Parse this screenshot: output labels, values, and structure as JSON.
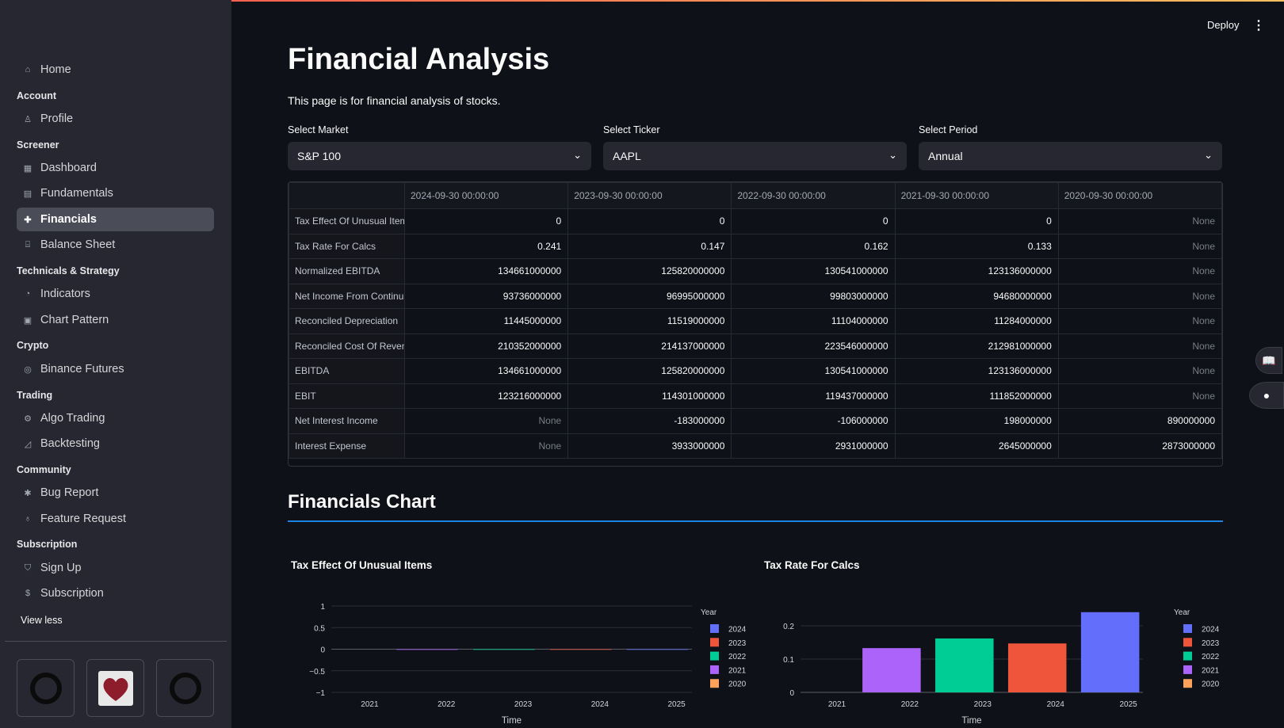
{
  "sidebar": {
    "items": [
      {
        "label": "Home",
        "icon": "home-icon",
        "glyph": "⌂"
      },
      {
        "label": "Profile",
        "icon": "user-icon",
        "glyph": "♙"
      },
      {
        "label": "Dashboard",
        "icon": "dashboard-icon",
        "glyph": "▦"
      },
      {
        "label": "Fundamentals",
        "icon": "document-icon",
        "glyph": "▤"
      },
      {
        "label": "Financials",
        "icon": "puzzle-icon",
        "glyph": "✚"
      },
      {
        "label": "Balance Sheet",
        "icon": "bank-icon",
        "glyph": "⌸"
      },
      {
        "label": "Indicators",
        "icon": "gauge-icon",
        "glyph": "◔"
      },
      {
        "label": "Chart Pattern",
        "icon": "chart-icon",
        "glyph": "▣"
      },
      {
        "label": "Binance Futures",
        "icon": "currency-icon",
        "glyph": "◎"
      },
      {
        "label": "Algo Trading",
        "icon": "robot-icon",
        "glyph": "⚙"
      },
      {
        "label": "Backtesting",
        "icon": "area-chart-icon",
        "glyph": "◿"
      },
      {
        "label": "Bug Report",
        "icon": "bug-icon",
        "glyph": "✱"
      },
      {
        "label": "Feature Request",
        "icon": "lightbulb-icon",
        "glyph": "♁"
      },
      {
        "label": "Sign Up",
        "icon": "shield-icon",
        "glyph": "⛉"
      },
      {
        "label": "Subscription",
        "icon": "dollar-icon",
        "glyph": "$"
      }
    ],
    "sections": [
      "Account",
      "Screener",
      "Technicals & Strategy",
      "Crypto",
      "Trading",
      "Community",
      "Subscription"
    ],
    "view_less": "View less"
  },
  "header": {
    "deploy": "Deploy",
    "menu": "⋮"
  },
  "page": {
    "title": "Financial Analysis",
    "subtitle": "This page is for financial analysis of stocks."
  },
  "selects": [
    {
      "label": "Select Market",
      "value": "S&P 100"
    },
    {
      "label": "Select Ticker",
      "value": "AAPL"
    },
    {
      "label": "Select Period",
      "value": "Annual"
    }
  ],
  "table": {
    "columns": [
      "",
      "2024-09-30 00:00:00",
      "2023-09-30 00:00:00",
      "2022-09-30 00:00:00",
      "2021-09-30 00:00:00",
      "2020-09-30 00:00:00"
    ],
    "rows": [
      [
        "Tax Effect Of Unusual Item",
        "0",
        "0",
        "0",
        "0",
        "None"
      ],
      [
        "Tax Rate For Calcs",
        "0.241",
        "0.147",
        "0.162",
        "0.133",
        "None"
      ],
      [
        "Normalized EBITDA",
        "134661000000",
        "125820000000",
        "130541000000",
        "123136000000",
        "None"
      ],
      [
        "Net Income From Continui",
        "93736000000",
        "96995000000",
        "99803000000",
        "94680000000",
        "None"
      ],
      [
        "Reconciled Depreciation",
        "11445000000",
        "11519000000",
        "11104000000",
        "11284000000",
        "None"
      ],
      [
        "Reconciled Cost Of Revenu",
        "210352000000",
        "214137000000",
        "223546000000",
        "212981000000",
        "None"
      ],
      [
        "EBITDA",
        "134661000000",
        "125820000000",
        "130541000000",
        "123136000000",
        "None"
      ],
      [
        "EBIT",
        "123216000000",
        "114301000000",
        "119437000000",
        "111852000000",
        "None"
      ],
      [
        "Net Interest Income",
        "None",
        "-183000000",
        "-106000000",
        "198000000",
        "890000000"
      ],
      [
        "Interest Expense",
        "None",
        "3933000000",
        "2931000000",
        "2645000000",
        "2873000000"
      ]
    ]
  },
  "charts_header": "Financials Chart",
  "chart_data": [
    {
      "type": "bar",
      "title": "Tax Effect Of Unusual Items",
      "xlabel": "Time",
      "ylabel": "",
      "x_ticks": [
        "2021",
        "2022",
        "2023",
        "2024",
        "2025"
      ],
      "y_ticks": [
        "1",
        "0.5",
        "0",
        "−0.5",
        "−1"
      ],
      "ylim": [
        -1,
        1
      ],
      "legend_title": "Year",
      "legend_position": "right",
      "series": [
        {
          "name": "2024",
          "color": "#636efa",
          "x": 2024.75,
          "value": 0
        },
        {
          "name": "2023",
          "color": "#ef553b",
          "x": 2023.75,
          "value": 0
        },
        {
          "name": "2022",
          "color": "#00cc96",
          "x": 2022.75,
          "value": 0
        },
        {
          "name": "2021",
          "color": "#ab63fa",
          "x": 2021.75,
          "value": 0
        },
        {
          "name": "2020",
          "color": "#ffa15a",
          "x": 2020.75,
          "value": null
        }
      ]
    },
    {
      "type": "bar",
      "title": "Tax Rate For Calcs",
      "xlabel": "Time",
      "ylabel": "",
      "x_ticks": [
        "2021",
        "2022",
        "2023",
        "2024",
        "2025"
      ],
      "y_ticks": [
        "0.2",
        "0.1",
        "0"
      ],
      "ylim": [
        0,
        0.25
      ],
      "legend_title": "Year",
      "legend_position": "right",
      "series": [
        {
          "name": "2024",
          "color": "#636efa",
          "x": 2024.75,
          "value": 0.241
        },
        {
          "name": "2023",
          "color": "#ef553b",
          "x": 2023.75,
          "value": 0.147
        },
        {
          "name": "2022",
          "color": "#00cc96",
          "x": 2022.75,
          "value": 0.162
        },
        {
          "name": "2021",
          "color": "#ab63fa",
          "x": 2021.75,
          "value": 0.133
        },
        {
          "name": "2020",
          "color": "#ffa15a",
          "x": 2020.75,
          "value": null
        }
      ]
    }
  ]
}
